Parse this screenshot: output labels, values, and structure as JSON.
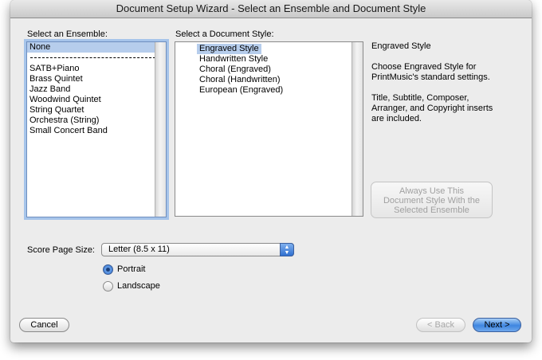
{
  "window": {
    "title": "Document Setup Wizard - Select an Ensemble and Document Style"
  },
  "ensemble": {
    "label": "Select an Ensemble:",
    "items": [
      "None",
      "SATB+Piano",
      "Brass Quintet",
      "Jazz Band",
      "Woodwind Quintet",
      "String Quartet",
      "Orchestra (String)",
      "Small Concert Band"
    ],
    "selected": "None"
  },
  "style": {
    "label": "Select a Document Style:",
    "items": [
      "Engraved Style",
      "Handwritten Style",
      "Choral (Engraved)",
      "Choral (Handwritten)",
      "European (Engraved)"
    ],
    "selected": "Engraved Style"
  },
  "description": {
    "title": "Engraved Style",
    "line1": "Choose Engraved Style for",
    "line2": "PrintMusic's standard settings.",
    "line3": "Title, Subtitle, Composer,",
    "line4": "Arranger, and Copyright inserts",
    "line5": "are included."
  },
  "always_use_button": {
    "line1": "Always Use This",
    "line2": "Document Style With the",
    "line3": "Selected Ensemble",
    "enabled": false
  },
  "page_size": {
    "label": "Score Page Size:",
    "value": "Letter (8.5 x 11)"
  },
  "orientation": {
    "portrait_label": "Portrait",
    "landscape_label": "Landscape",
    "selected": "Portrait"
  },
  "buttons": {
    "cancel": "Cancel",
    "back": "< Back",
    "next": "Next >"
  },
  "colors": {
    "selection": "#b6cdec",
    "focus_ring": "#a6c4ea",
    "default_button": "#3e86e0"
  }
}
